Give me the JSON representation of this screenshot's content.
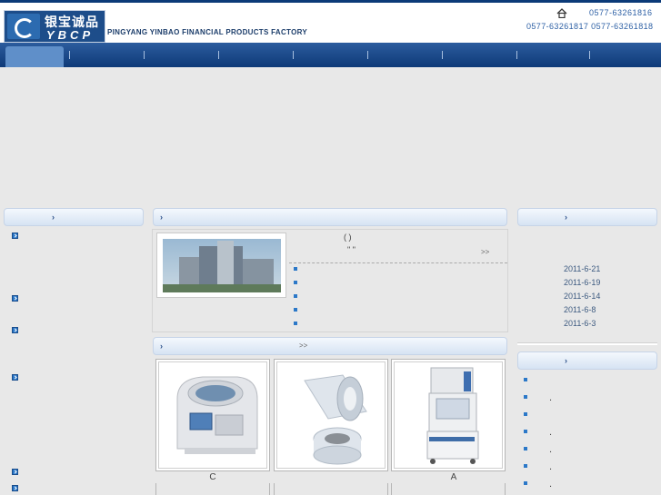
{
  "header": {
    "logo_cn": "银宝诚品",
    "logo_en": "YBCP",
    "company_en": "PINGYANG YINBAO FINANCIAL PRODUCTS FACTORY",
    "phone_top": "0577-63261816",
    "phone_bottom": "0577-63261817 0577-63261818"
  },
  "nav": {
    "items": [
      "",
      "",
      "",
      "",
      "",
      "",
      "",
      "",
      ""
    ]
  },
  "left_panel": {
    "header_arrow": "›",
    "items": [
      "",
      "",
      "",
      "",
      "",
      ""
    ]
  },
  "center_news": {
    "header_arrow": "›",
    "intro_line1": "(            )",
    "intro_line2": "\"       \"",
    "more": ">>",
    "bullets": [
      "",
      "",
      "",
      "",
      ""
    ]
  },
  "right_news": {
    "header_arrow": "›",
    "dates": [
      "2011-6-21",
      "2011-6-19",
      "2011-6-14",
      "2011-6-8",
      "2011-6-3"
    ]
  },
  "products": {
    "header_arrow": "›",
    "more": ">>",
    "captions": [
      "C",
      "",
      "A"
    ]
  },
  "right_panel2": {
    "header_arrow": "›",
    "items": [
      ".",
      ".",
      ".",
      ".",
      ".",
      "."
    ]
  }
}
